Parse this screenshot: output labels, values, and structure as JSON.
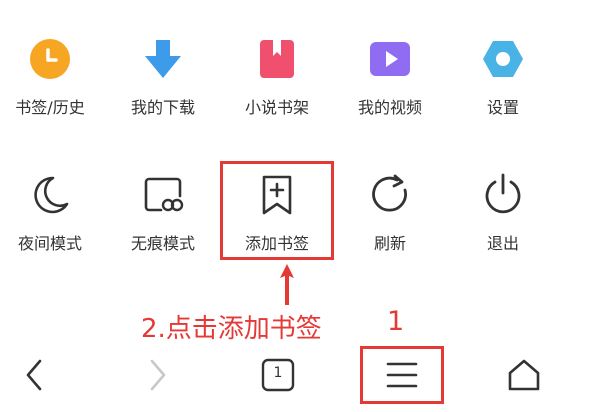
{
  "menu": {
    "row1": [
      {
        "label": "书签/历史",
        "icon": "bookmark-history-icon",
        "color": "#f6a623"
      },
      {
        "label": "我的下载",
        "icon": "download-icon",
        "color": "#3d9be9"
      },
      {
        "label": "小说书架",
        "icon": "novel-shelf-icon",
        "color": "#f0506e"
      },
      {
        "label": "我的视频",
        "icon": "video-icon",
        "color": "#8f6cf2"
      },
      {
        "label": "设置",
        "icon": "settings-icon",
        "color": "#4ab3e6"
      }
    ],
    "row2": [
      {
        "label": "夜间模式",
        "icon": "night-mode-icon"
      },
      {
        "label": "无痕模式",
        "icon": "incognito-icon"
      },
      {
        "label": "添加书签",
        "icon": "add-bookmark-icon"
      },
      {
        "label": "刷新",
        "icon": "refresh-icon"
      },
      {
        "label": "退出",
        "icon": "power-icon"
      }
    ]
  },
  "annotations": {
    "step2": "2.点击添加书签",
    "step1": "1",
    "color": "#e53935"
  },
  "bottom_nav": {
    "tab_count": "1",
    "items": [
      "back-icon",
      "forward-icon",
      "tabs-icon",
      "menu-icon",
      "home-icon"
    ]
  }
}
